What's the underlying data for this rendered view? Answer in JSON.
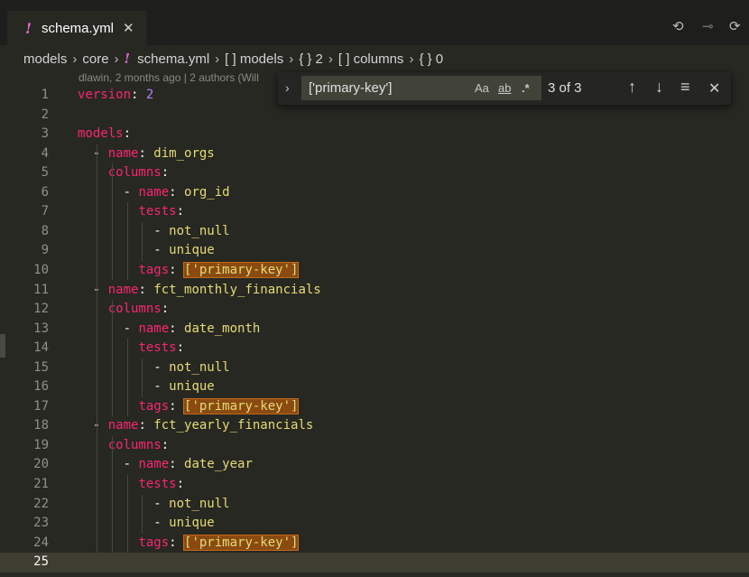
{
  "tab": {
    "icon": "!",
    "filename": "schema.yml",
    "close": "✕"
  },
  "toolbar": {
    "back": "⟲",
    "commit": "⊸",
    "forward": "⟳"
  },
  "breadcrumb": {
    "items": [
      "models",
      "core",
      "schema.yml",
      "[ ] models",
      "{ } 2",
      "[ ] columns",
      "{ } 0"
    ],
    "separator": "›",
    "file_icon": "!"
  },
  "blame": "dlawin, 2 months ago | 2 authors (Will",
  "find": {
    "toggle": "›",
    "value": "['primary-key']",
    "match_case": "Aa",
    "whole_word": "ab",
    "regex": ".*",
    "count": "3 of 3",
    "prev": "↑",
    "next": "↓",
    "select_all": "≡",
    "close": "✕"
  },
  "current_line": 25,
  "lines": [
    {
      "n": "1",
      "parts": [
        [
          "k",
          "version"
        ],
        [
          "w",
          ": "
        ],
        [
          "n",
          "2"
        ]
      ]
    },
    {
      "n": "2",
      "parts": []
    },
    {
      "n": "3",
      "parts": [
        [
          "k",
          "models"
        ],
        [
          "w",
          ":"
        ]
      ]
    },
    {
      "n": "4",
      "parts": [
        [
          "w",
          "  - "
        ],
        [
          "k",
          "name"
        ],
        [
          "w",
          ": "
        ],
        [
          "s",
          "dim_orgs"
        ]
      ]
    },
    {
      "n": "5",
      "parts": [
        [
          "w",
          "    "
        ],
        [
          "k",
          "columns"
        ],
        [
          "w",
          ":"
        ]
      ]
    },
    {
      "n": "6",
      "parts": [
        [
          "w",
          "      - "
        ],
        [
          "k",
          "name"
        ],
        [
          "w",
          ": "
        ],
        [
          "s",
          "org_id"
        ]
      ]
    },
    {
      "n": "7",
      "parts": [
        [
          "w",
          "        "
        ],
        [
          "k",
          "tests"
        ],
        [
          "w",
          ":"
        ]
      ]
    },
    {
      "n": "8",
      "parts": [
        [
          "w",
          "          - "
        ],
        [
          "s",
          "not_null"
        ]
      ]
    },
    {
      "n": "9",
      "parts": [
        [
          "w",
          "          - "
        ],
        [
          "s",
          "unique"
        ]
      ]
    },
    {
      "n": "10",
      "parts": [
        [
          "w",
          "        "
        ],
        [
          "k",
          "tags"
        ],
        [
          "w",
          ": "
        ],
        [
          "hl",
          "['primary-key']"
        ]
      ]
    },
    {
      "n": "11",
      "parts": [
        [
          "w",
          "  - "
        ],
        [
          "k",
          "name"
        ],
        [
          "w",
          ": "
        ],
        [
          "s",
          "fct_monthly_financials"
        ]
      ]
    },
    {
      "n": "12",
      "parts": [
        [
          "w",
          "    "
        ],
        [
          "k",
          "columns"
        ],
        [
          "w",
          ":"
        ]
      ]
    },
    {
      "n": "13",
      "parts": [
        [
          "w",
          "      - "
        ],
        [
          "k",
          "name"
        ],
        [
          "w",
          ": "
        ],
        [
          "s",
          "date_month"
        ]
      ]
    },
    {
      "n": "14",
      "parts": [
        [
          "w",
          "        "
        ],
        [
          "k",
          "tests"
        ],
        [
          "w",
          ":"
        ]
      ]
    },
    {
      "n": "15",
      "parts": [
        [
          "w",
          "          - "
        ],
        [
          "s",
          "not_null"
        ]
      ]
    },
    {
      "n": "16",
      "parts": [
        [
          "w",
          "          - "
        ],
        [
          "s",
          "unique"
        ]
      ]
    },
    {
      "n": "17",
      "parts": [
        [
          "w",
          "        "
        ],
        [
          "k",
          "tags"
        ],
        [
          "w",
          ": "
        ],
        [
          "hl",
          "['primary-key']"
        ]
      ]
    },
    {
      "n": "18",
      "parts": [
        [
          "w",
          "  - "
        ],
        [
          "k",
          "name"
        ],
        [
          "w",
          ": "
        ],
        [
          "s",
          "fct_yearly_financials"
        ]
      ]
    },
    {
      "n": "19",
      "parts": [
        [
          "w",
          "    "
        ],
        [
          "k",
          "columns"
        ],
        [
          "w",
          ":"
        ]
      ]
    },
    {
      "n": "20",
      "parts": [
        [
          "w",
          "      - "
        ],
        [
          "k",
          "name"
        ],
        [
          "w",
          ": "
        ],
        [
          "s",
          "date_year"
        ]
      ]
    },
    {
      "n": "21",
      "parts": [
        [
          "w",
          "        "
        ],
        [
          "k",
          "tests"
        ],
        [
          "w",
          ":"
        ]
      ]
    },
    {
      "n": "22",
      "parts": [
        [
          "w",
          "          - "
        ],
        [
          "s",
          "not_null"
        ]
      ]
    },
    {
      "n": "23",
      "parts": [
        [
          "w",
          "          - "
        ],
        [
          "s",
          "unique"
        ]
      ]
    },
    {
      "n": "24",
      "parts": [
        [
          "w",
          "        "
        ],
        [
          "k",
          "tags"
        ],
        [
          "w",
          ": "
        ],
        [
          "hl",
          "['primary-key']"
        ]
      ]
    },
    {
      "n": "25",
      "parts": []
    }
  ]
}
